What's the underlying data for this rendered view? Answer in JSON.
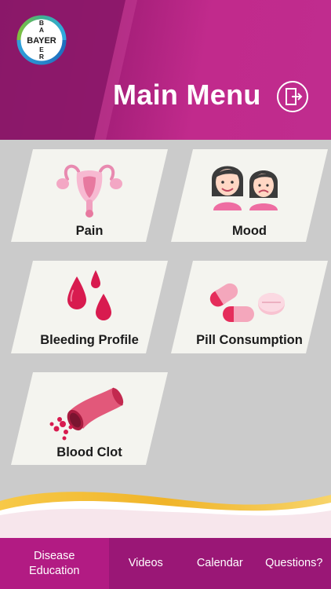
{
  "header": {
    "logo_text": "BAYER",
    "title": "Main Menu",
    "exit_icon": "exit-door-icon"
  },
  "menu": {
    "items": [
      {
        "label": "Pain",
        "icon": "uterus-icon"
      },
      {
        "label": "Mood",
        "icon": "mood-faces-icon"
      },
      {
        "label": "Bleeding Profile",
        "icon": "blood-drops-icon"
      },
      {
        "label": "Pill Consumption",
        "icon": "pills-icon"
      },
      {
        "label": "Blood Clot",
        "icon": "blood-vessel-icon"
      }
    ]
  },
  "bottom_nav": {
    "items": [
      {
        "label": "Disease Education"
      },
      {
        "label": "Videos"
      },
      {
        "label": "Calendar"
      },
      {
        "label": "Questions?"
      }
    ]
  },
  "colors": {
    "header": "#a51f79",
    "bottom_nav": "#9a1776",
    "accent_pink": "#e8447a",
    "gold": "#f0b429"
  }
}
